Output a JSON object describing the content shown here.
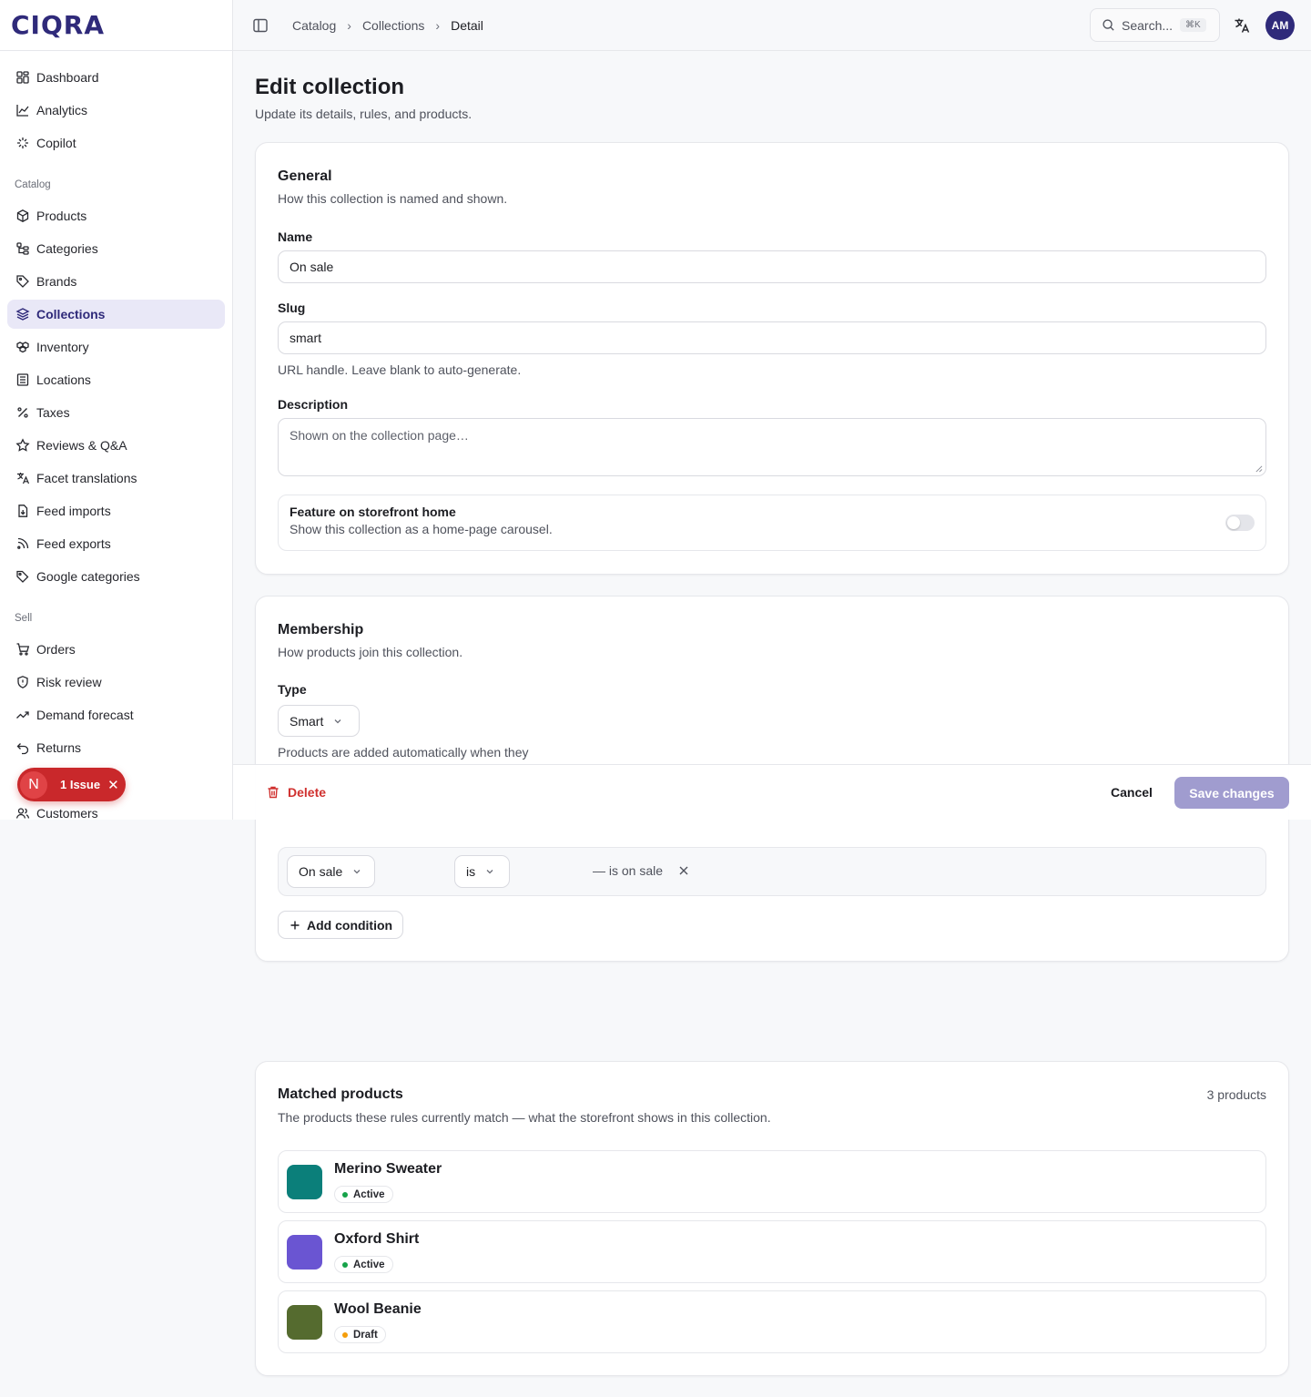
{
  "brand": {
    "logo": "CIQRA"
  },
  "sidebar": {
    "top_items": [
      {
        "label": "Dashboard",
        "icon": "dashboard-icon"
      },
      {
        "label": "Analytics",
        "icon": "analytics-icon"
      },
      {
        "label": "Copilot",
        "icon": "copilot-icon"
      }
    ],
    "catalog_heading": "Catalog",
    "catalog_items": [
      {
        "label": "Products",
        "icon": "package-icon"
      },
      {
        "label": "Categories",
        "icon": "categories-icon"
      },
      {
        "label": "Brands",
        "icon": "tag-icon"
      },
      {
        "label": "Collections",
        "icon": "layers-icon",
        "active": true
      },
      {
        "label": "Inventory",
        "icon": "boxes-icon"
      },
      {
        "label": "Locations",
        "icon": "building-icon"
      },
      {
        "label": "Taxes",
        "icon": "percent-icon"
      },
      {
        "label": "Reviews & Q&A",
        "icon": "star-icon"
      },
      {
        "label": "Facet translations",
        "icon": "translate-icon"
      },
      {
        "label": "Feed imports",
        "icon": "file-import-icon"
      },
      {
        "label": "Feed exports",
        "icon": "rss-icon"
      },
      {
        "label": "Google categories",
        "icon": "tags-icon"
      }
    ],
    "sell_heading": "Sell",
    "sell_items": [
      {
        "label": "Orders",
        "icon": "cart-icon"
      },
      {
        "label": "Risk review",
        "icon": "shield-icon"
      },
      {
        "label": "Demand forecast",
        "icon": "trend-icon"
      },
      {
        "label": "Returns",
        "icon": "undo-icon"
      }
    ],
    "customers_label": "Customers",
    "issue_pill": {
      "letter": "N",
      "label": "1 Issue"
    }
  },
  "topbar": {
    "breadcrumbs": [
      "Catalog",
      "Collections",
      "Detail"
    ],
    "search_placeholder": "Search...",
    "search_shortcut": "⌘K",
    "avatar_initials": "AM"
  },
  "page": {
    "title": "Edit collection",
    "subtitle": "Update its details, rules, and products."
  },
  "general": {
    "title": "General",
    "subtitle": "How this collection is named and shown.",
    "name_label": "Name",
    "name_value": "On sale",
    "slug_label": "Slug",
    "slug_value": "smart",
    "slug_hint": "URL handle. Leave blank to auto-generate.",
    "description_label": "Description",
    "description_placeholder": "Shown on the collection page…",
    "feature_title": "Feature on storefront home",
    "feature_sub": "Show this collection as a home-page carousel.",
    "feature_on": false
  },
  "membership": {
    "title": "Membership",
    "subtitle": "How products join this collection.",
    "type_label": "Type",
    "type_value": "Smart",
    "type_hint": "Products are added automatically when they",
    "condition": {
      "field": "On sale",
      "operator": "is",
      "value_text": "— is on sale"
    },
    "add_condition_label": "Add condition"
  },
  "actionbar": {
    "delete_label": "Delete",
    "cancel_label": "Cancel",
    "save_label": "Save changes"
  },
  "matched": {
    "title": "Matched products",
    "subtitle": "The products these rules currently match — what the storefront shows in this collection.",
    "count_label": "3 products",
    "products": [
      {
        "name": "Merino Sweater",
        "status": "Active",
        "swatch": "#0b7f7a",
        "status_color": "#16a34a"
      },
      {
        "name": "Oxford Shirt",
        "status": "Active",
        "swatch": "#6a55d2",
        "status_color": "#16a34a"
      },
      {
        "name": "Wool Beanie",
        "status": "Draft",
        "swatch": "#556b2f",
        "status_color": "#f59e0b"
      }
    ]
  },
  "colors": {
    "brand": "#2f2a7a",
    "active_nav_bg": "#e9e8f7",
    "danger": "#d0312f",
    "save_disabled": "#a09ccf"
  }
}
